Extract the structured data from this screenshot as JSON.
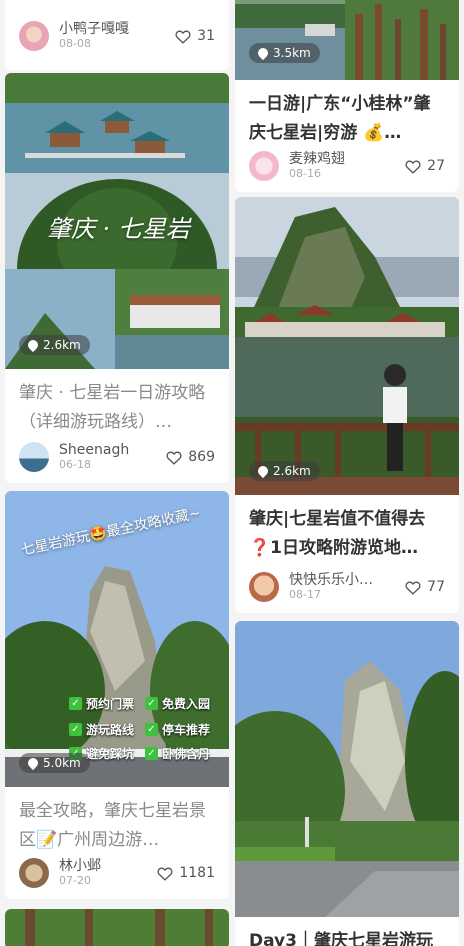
{
  "cards": {
    "c0": {
      "author": "小鸭子嘎嘎",
      "date": "08-08",
      "likes": "31"
    },
    "c1": {
      "distance": "3.5km",
      "title": "一日游|广东“小桂林”肇庆七星岩|穷游 💰…",
      "author": "麦辣鸡翅",
      "date": "08-16",
      "likes": "27"
    },
    "c2": {
      "image_text": "肇庆 · 七星岩",
      "distance": "2.6km",
      "title": "肇庆 · 七星岩一日游攻略（详细游玩路线）…",
      "author": "Sheenagh",
      "date": "06-18",
      "likes": "869"
    },
    "c3": {
      "distance": "2.6km",
      "title": "肇庆|七星岩值不值得去❓1日攻略附游览地…",
      "author": "快快乐乐小…",
      "date": "08-17",
      "likes": "77"
    },
    "c4": {
      "image_text": "七星岩游玩🤩最全攻略收藏~",
      "checks": [
        "预约门票",
        "免费入园",
        "游玩路线",
        "停车推荐",
        "避免踩坑",
        "卧佛含丹"
      ],
      "distance": "5.0km",
      "title": "最全攻略，肇庆七星岩景区📝广州周边游…",
      "author": "林小邺",
      "date": "07-20",
      "likes": "1181"
    },
    "c6": {
      "title": "Day3｜肇庆七星岩游玩"
    }
  },
  "colors": {
    "heart": "#555555",
    "sky": "#8fb6e8",
    "lake": "#5d7f6e",
    "green": "#3d6b2f"
  },
  "icons": [
    "heart-icon",
    "location-pin-icon",
    "check-icon"
  ]
}
